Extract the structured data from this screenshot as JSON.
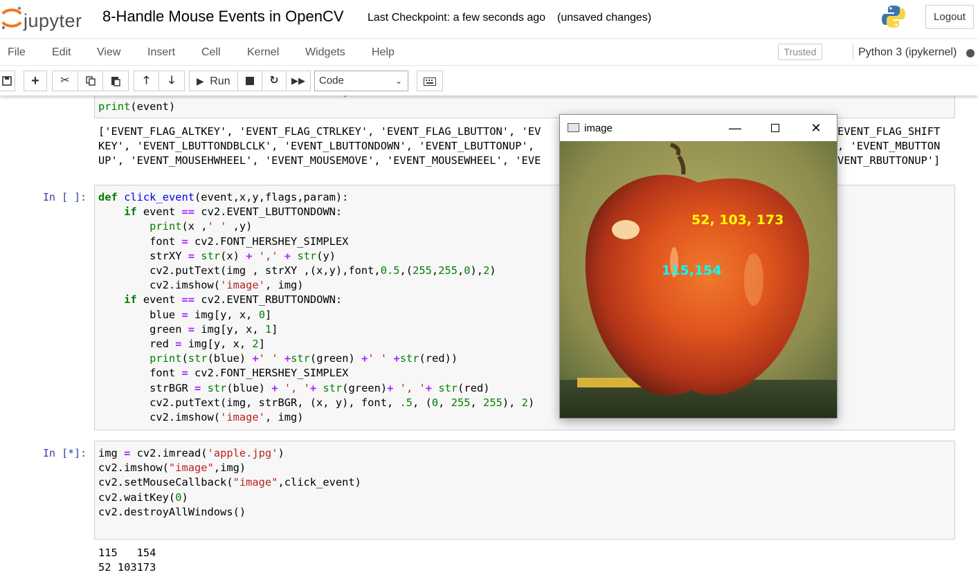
{
  "header": {
    "logo_text": "jupyter",
    "notebook_title": "8-Handle Mouse Events in OpenCV",
    "checkpoint": "Last Checkpoint: a few seconds ago",
    "unsaved": "(unsaved changes)",
    "logout_label": "Logout"
  },
  "menubar": {
    "items": [
      "File",
      "Edit",
      "View",
      "Insert",
      "Cell",
      "Kernel",
      "Widgets",
      "Help"
    ],
    "trusted_label": "Trusted",
    "kernel_name": "Python 3 (ipykernel)"
  },
  "toolbar": {
    "run_label": "Run",
    "cell_type": "Code",
    "icons": [
      "save-icon",
      "plus-icon",
      "cut-icon",
      "copy-icon",
      "paste-icon",
      "arrow-up-icon",
      "arrow-down-icon",
      "run-icon",
      "stop-icon",
      "restart-icon",
      "fast-forward-icon",
      "keyboard-icon"
    ]
  },
  "cells": {
    "cell0": {
      "code_line": "print(event)",
      "output_lines": [
        "['EVENT_FLAG_ALTKEY', 'EVENT_FLAG_CTRLKEY', 'EVENT_FLAG_LBUTTON', 'EV",
        "KEY', 'EVENT_LBUTTONDBLCLK', 'EVENT_LBUTTONDOWN', 'EVENT_LBUTTONUP',",
        "UP', 'EVENT_MOUSEHWHEEL', 'EVENT_MOUSEMOVE', 'EVENT_MOUSEWHEEL', 'EVE"
      ],
      "output_right_lines": [
        "EVENT_FLAG_SHIFT",
        ", 'EVENT_MBUTTON",
        "VENT_RBUTTONUP']"
      ]
    },
    "cell1": {
      "prompt": "In [ ]:"
    },
    "cell2": {
      "prompt": "In [*]:",
      "output_lines": [
        "115   154",
        "52 103173"
      ]
    }
  },
  "image_window": {
    "title": "image",
    "yellow_label": "52, 103, 173",
    "cyan_label": "115,154"
  },
  "colors": {
    "prompt_in": "#303f9f",
    "keyword": "#008000",
    "string": "#ba2121",
    "operator": "#aa22ff",
    "label_yellow": "#ffff00",
    "label_cyan": "#00ffff"
  }
}
